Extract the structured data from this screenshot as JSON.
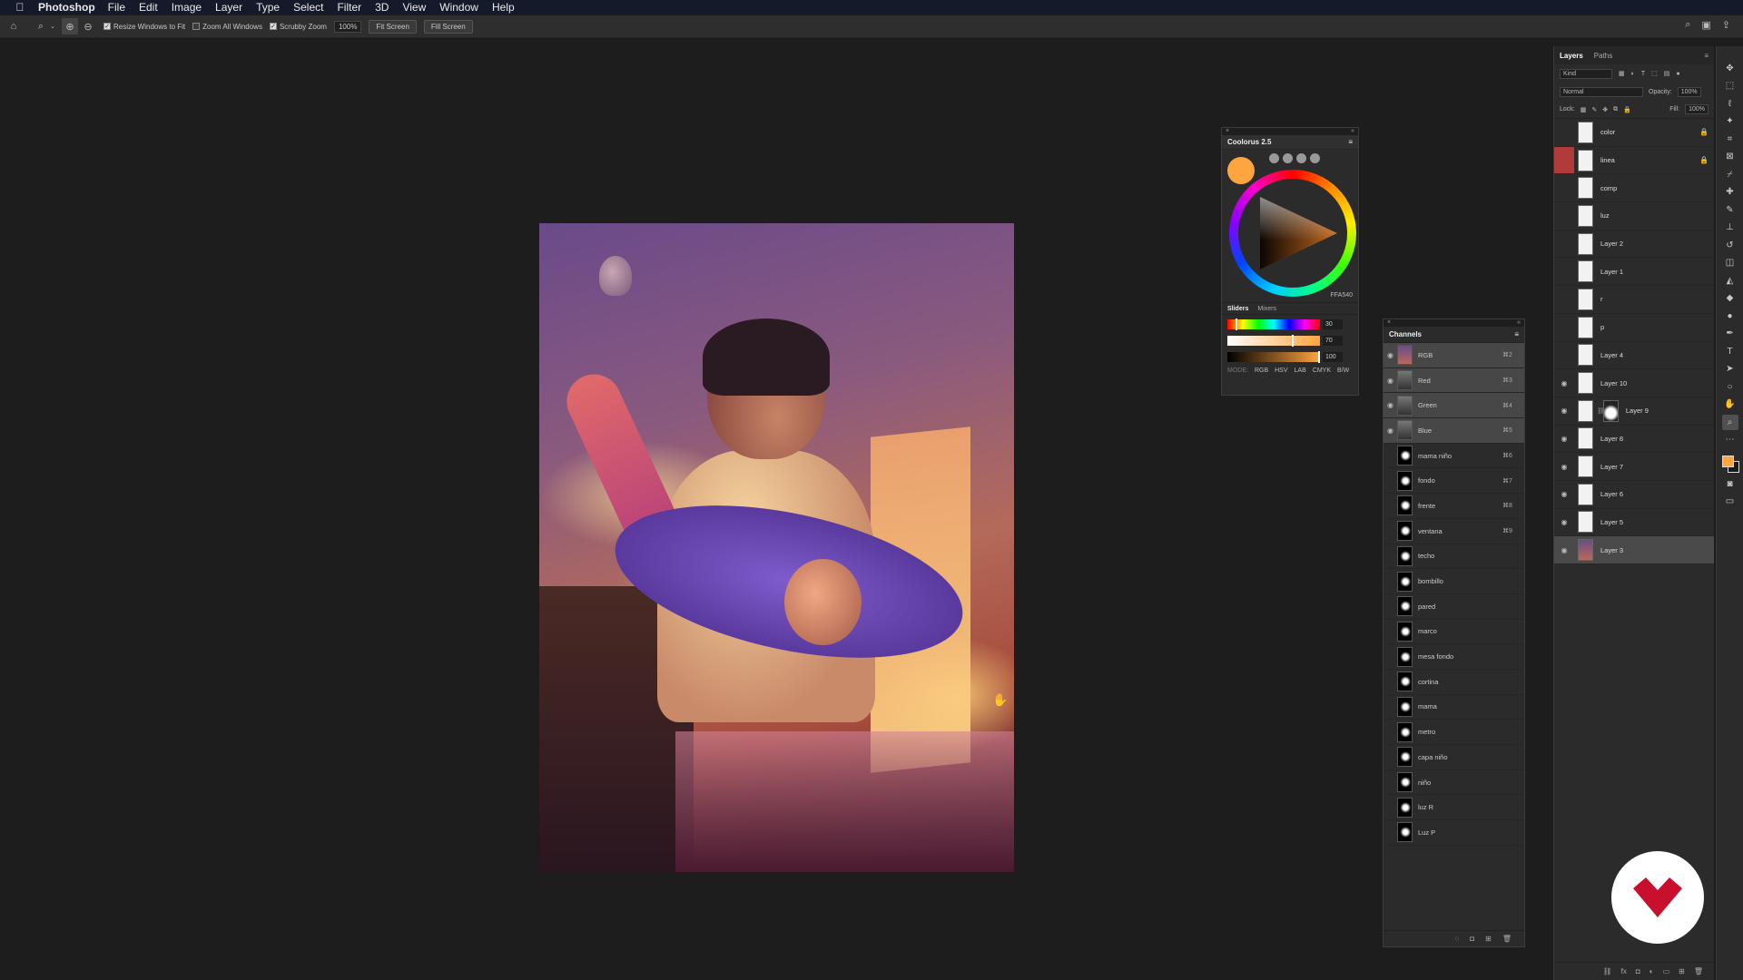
{
  "menubar": {
    "apple_icon": "apple-icon",
    "items": [
      "Photoshop",
      "File",
      "Edit",
      "Image",
      "Layer",
      "Type",
      "Select",
      "Filter",
      "3D",
      "View",
      "Window",
      "Help"
    ]
  },
  "options_bar": {
    "resize_windows": "Resize Windows to Fit",
    "zoom_all": "Zoom All Windows",
    "scrubby_zoom": "Scrubby Zoom",
    "zoom_value": "100%",
    "fit_screen": "Fit Screen",
    "fill_screen": "Fill Screen"
  },
  "coolorus": {
    "title": "Coolorus 2.5",
    "hex": "FFA540",
    "current_color": "#ffa540",
    "tabs": [
      "Sliders",
      "Mixers"
    ],
    "slider_values": [
      "30",
      "70",
      "100"
    ],
    "mode_label": "MODE:",
    "modes": [
      "RGB",
      "HSV",
      "LAB",
      "CMYK",
      "B/W"
    ]
  },
  "channels": {
    "title": "Channels",
    "rows": [
      {
        "name": "RGB",
        "shortcut": "⌘2",
        "eye": true,
        "thumb": "comp",
        "selected": true
      },
      {
        "name": "Red",
        "shortcut": "⌘3",
        "eye": true,
        "thumb": "gray",
        "selected": true
      },
      {
        "name": "Green",
        "shortcut": "⌘4",
        "eye": true,
        "thumb": "gray",
        "selected": true
      },
      {
        "name": "Blue",
        "shortcut": "⌘5",
        "eye": true,
        "thumb": "gray",
        "selected": true
      },
      {
        "name": "mama niño",
        "shortcut": "⌘6",
        "eye": false,
        "thumb": "mask",
        "selected": false
      },
      {
        "name": "fondo",
        "shortcut": "⌘7",
        "eye": false,
        "thumb": "mask",
        "selected": false
      },
      {
        "name": "frente",
        "shortcut": "⌘8",
        "eye": false,
        "thumb": "mask",
        "selected": false
      },
      {
        "name": "ventana",
        "shortcut": "⌘9",
        "eye": false,
        "thumb": "mask",
        "selected": false
      },
      {
        "name": "techo",
        "shortcut": "",
        "eye": false,
        "thumb": "mask",
        "selected": false
      },
      {
        "name": "bombillo",
        "shortcut": "",
        "eye": false,
        "thumb": "mask",
        "selected": false
      },
      {
        "name": "pared",
        "shortcut": "",
        "eye": false,
        "thumb": "mask",
        "selected": false
      },
      {
        "name": "marco",
        "shortcut": "",
        "eye": false,
        "thumb": "mask",
        "selected": false
      },
      {
        "name": "mesa fondo",
        "shortcut": "",
        "eye": false,
        "thumb": "mask",
        "selected": false
      },
      {
        "name": "cortina",
        "shortcut": "",
        "eye": false,
        "thumb": "mask",
        "selected": false
      },
      {
        "name": "mama",
        "shortcut": "",
        "eye": false,
        "thumb": "mask",
        "selected": false
      },
      {
        "name": "metro",
        "shortcut": "",
        "eye": false,
        "thumb": "mask",
        "selected": false
      },
      {
        "name": "capa niño",
        "shortcut": "",
        "eye": false,
        "thumb": "mask",
        "selected": false
      },
      {
        "name": "niño",
        "shortcut": "",
        "eye": false,
        "thumb": "mask",
        "selected": false
      },
      {
        "name": "luz R",
        "shortcut": "",
        "eye": false,
        "thumb": "mask",
        "selected": false
      },
      {
        "name": "Luz P",
        "shortcut": "",
        "eye": false,
        "thumb": "mask",
        "selected": false
      }
    ]
  },
  "layers": {
    "tabs": [
      "Layers",
      "Paths"
    ],
    "kind": "Kind",
    "blend_mode": "Normal",
    "opacity_label": "Opacity:",
    "opacity": "100%",
    "lock_label": "Lock:",
    "fill_label": "Fill:",
    "fill": "100%",
    "rows": [
      {
        "name": "color",
        "eye": false,
        "locked": true,
        "red": false,
        "selected": false,
        "mask": false,
        "img": false
      },
      {
        "name": "linea",
        "eye": false,
        "locked": true,
        "red": true,
        "selected": false,
        "mask": false,
        "img": false
      },
      {
        "name": "comp",
        "eye": false,
        "locked": false,
        "red": false,
        "selected": false,
        "mask": false,
        "img": false
      },
      {
        "name": "luz",
        "eye": false,
        "locked": false,
        "red": false,
        "selected": false,
        "mask": false,
        "img": false
      },
      {
        "name": "Layer 2",
        "eye": false,
        "locked": false,
        "red": false,
        "selected": false,
        "mask": false,
        "img": false
      },
      {
        "name": "Layer 1",
        "eye": false,
        "locked": false,
        "red": false,
        "selected": false,
        "mask": false,
        "img": false
      },
      {
        "name": "r",
        "eye": false,
        "locked": false,
        "red": false,
        "selected": false,
        "mask": false,
        "img": false
      },
      {
        "name": "p",
        "eye": false,
        "locked": false,
        "red": false,
        "selected": false,
        "mask": false,
        "img": false
      },
      {
        "name": "Layer 4",
        "eye": false,
        "locked": false,
        "red": false,
        "selected": false,
        "mask": false,
        "img": false
      },
      {
        "name": "Layer 10",
        "eye": true,
        "locked": false,
        "red": false,
        "selected": false,
        "mask": false,
        "img": false
      },
      {
        "name": "Layer 9",
        "eye": true,
        "locked": false,
        "red": false,
        "selected": false,
        "mask": true,
        "img": false
      },
      {
        "name": "Layer 8",
        "eye": true,
        "locked": false,
        "red": false,
        "selected": false,
        "mask": false,
        "img": false
      },
      {
        "name": "Layer 7",
        "eye": true,
        "locked": false,
        "red": false,
        "selected": false,
        "mask": false,
        "img": false
      },
      {
        "name": "Layer 6",
        "eye": true,
        "locked": false,
        "red": false,
        "selected": false,
        "mask": false,
        "img": false
      },
      {
        "name": "Layer 5",
        "eye": true,
        "locked": false,
        "red": false,
        "selected": false,
        "mask": false,
        "img": false
      },
      {
        "name": "Layer 3",
        "eye": true,
        "locked": false,
        "red": false,
        "selected": true,
        "mask": false,
        "img": true
      }
    ]
  },
  "colors": {
    "foreground": "#ffa540",
    "background": "#1a1a1a",
    "brand": "#c8102e"
  }
}
